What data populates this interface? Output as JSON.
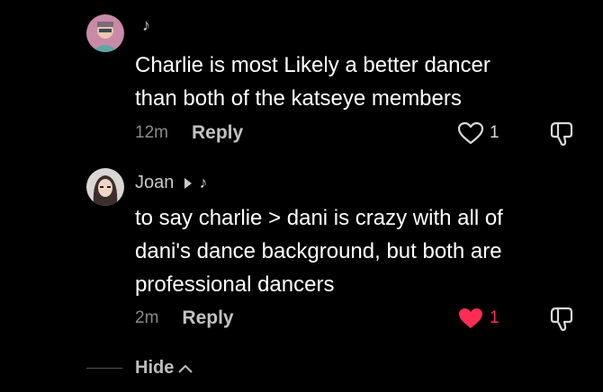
{
  "comments": [
    {
      "username": "",
      "music_note": "♪",
      "text_lines": [
        "Charlie is most Likely a better dancer",
        "than both of the katseye members"
      ],
      "time": "12m",
      "reply_label": "Reply",
      "likes": "1",
      "liked": false,
      "avatar_icon": "person-avatar"
    },
    {
      "username": "Joan",
      "music_note": "♪",
      "text_lines": [
        "to say charlie > dani is crazy with all of",
        "dani's dance background, but both are",
        "professional dancers"
      ],
      "time": "2m",
      "reply_label": "Reply",
      "likes": "1",
      "liked": true,
      "avatar_icon": "person-avatar"
    }
  ],
  "hide_label": "Hide",
  "colors": {
    "background": "#000000",
    "liked_heart": "#fe2c55",
    "text": "#ffffff",
    "muted": "#8a8a8a"
  }
}
